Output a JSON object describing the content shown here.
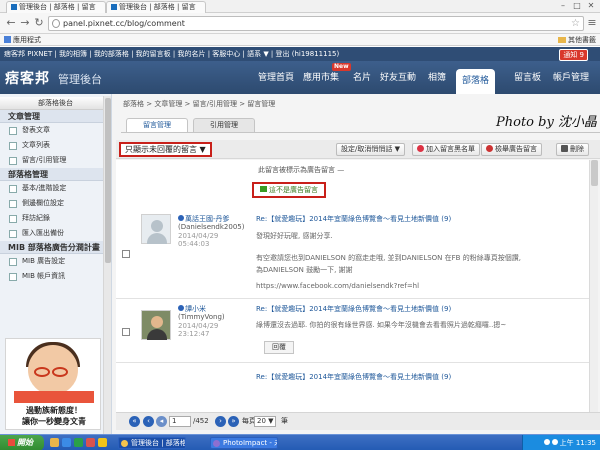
{
  "browser": {
    "tabs": [
      {
        "label": "管理後台 | 部落格 | 留言"
      },
      {
        "label": "管理後台 | 部落格 | 留言"
      }
    ],
    "url": "panel.pixnet.cc/blog/comment",
    "bookmarks": {
      "apps": "應用程式",
      "other": "其他書籤"
    }
  },
  "sitenav": {
    "text": "痞客邦 PIXNET | 我的相簿 | 我的部落格 | 我的留言板 | 我的名片 | 客服中心 | 語系 ▼ | 登出 (hi19811115)",
    "notice": "通知 9"
  },
  "header": {
    "logo": "痞客邦",
    "subtitle": "管理後台",
    "nav": [
      "管理首頁",
      "應用市集",
      "名片",
      "好友互動",
      "相簿",
      "部落格",
      "留言板",
      "帳戶管理"
    ],
    "new_badge": "New",
    "active": "部落格"
  },
  "sidebar": {
    "title": "部落格後台",
    "sections": [
      {
        "title": "文章管理",
        "items": [
          "發表文章",
          "文章列表",
          "留言/引用管理"
        ]
      },
      {
        "title": "部落格管理",
        "items": [
          "基本/進階設定",
          "側邊欄位設定",
          "拜訪紀錄",
          "匯入匯出備份"
        ]
      },
      {
        "title": "MIB 部落格廣告分潤計畫",
        "items": [
          "MIB 廣告設定",
          "MIB 帳戶資訊"
        ]
      }
    ],
    "ad": {
      "line1": "過動族新態度！",
      "line2": "讓你一秒變身文青"
    }
  },
  "main": {
    "breadcrumb": "部落格 > 文章管理 > 留言/引用管理 > 留言管理",
    "tabs": [
      "留言管理",
      "引用管理"
    ],
    "watermark": "Photo by 沈小晶",
    "filter": "只顯示未回覆的留言 ▼",
    "actions": {
      "toggle": "設定/取消悄悄話 ▼",
      "blacklist": "加入留言黑名單",
      "report_ad": "檢舉廣告留言",
      "delete": "刪除"
    },
    "ad_notice": "此留言被標示為廣告留言 —",
    "not_ad_button": "這不是廣告留言",
    "comments": [
      {
        "name": "萬話王國-丹爹",
        "id": "(Danielsendk2005)",
        "date": "2014/04/29",
        "time": "05:44:03",
        "title": "Re:【就愛趣玩】2014年宜蘭綠色博覽會～看見土地新價值 (9)",
        "lines": [
          "發現好好玩喔, 感謝分享.",
          "有空邀請您也到DANIELSON 的窩走走哦, 並到DANIELSON 在FB 的粉絲專頁按個讚,",
          "為DANIELSON 鼓勵一下, 謝謝",
          "https://www.facebook.com/danielsendk?ref=hl"
        ]
      },
      {
        "name": "譚小米",
        "id": "(TimmyVong)",
        "date": "2014/04/29",
        "time": "23:12:47",
        "title": "Re:【就愛趣玩】2014年宜蘭綠色博覽會～看見土地新價值 (9)",
        "lines": [
          "綠博還沒去過耶. 你拍的很有綠世界感. 如果今年沒機會去看看照片過乾癮囉..摁~"
        ],
        "reply": "回覆"
      },
      {
        "title": "Re:【就愛趣玩】2014年宜蘭綠色博覽會～看見土地新價值 (9)"
      }
    ],
    "pager": {
      "current": "1",
      "total": "/452",
      "per_page_label": "每頁",
      "per_page": "20 ▼",
      "unit": "筆"
    }
  },
  "taskbar": {
    "start": "開始",
    "tasks": [
      "管理後台 | 部落格 -",
      "PhotoImpact - 未命名"
    ],
    "clock": "上午 11:35"
  }
}
